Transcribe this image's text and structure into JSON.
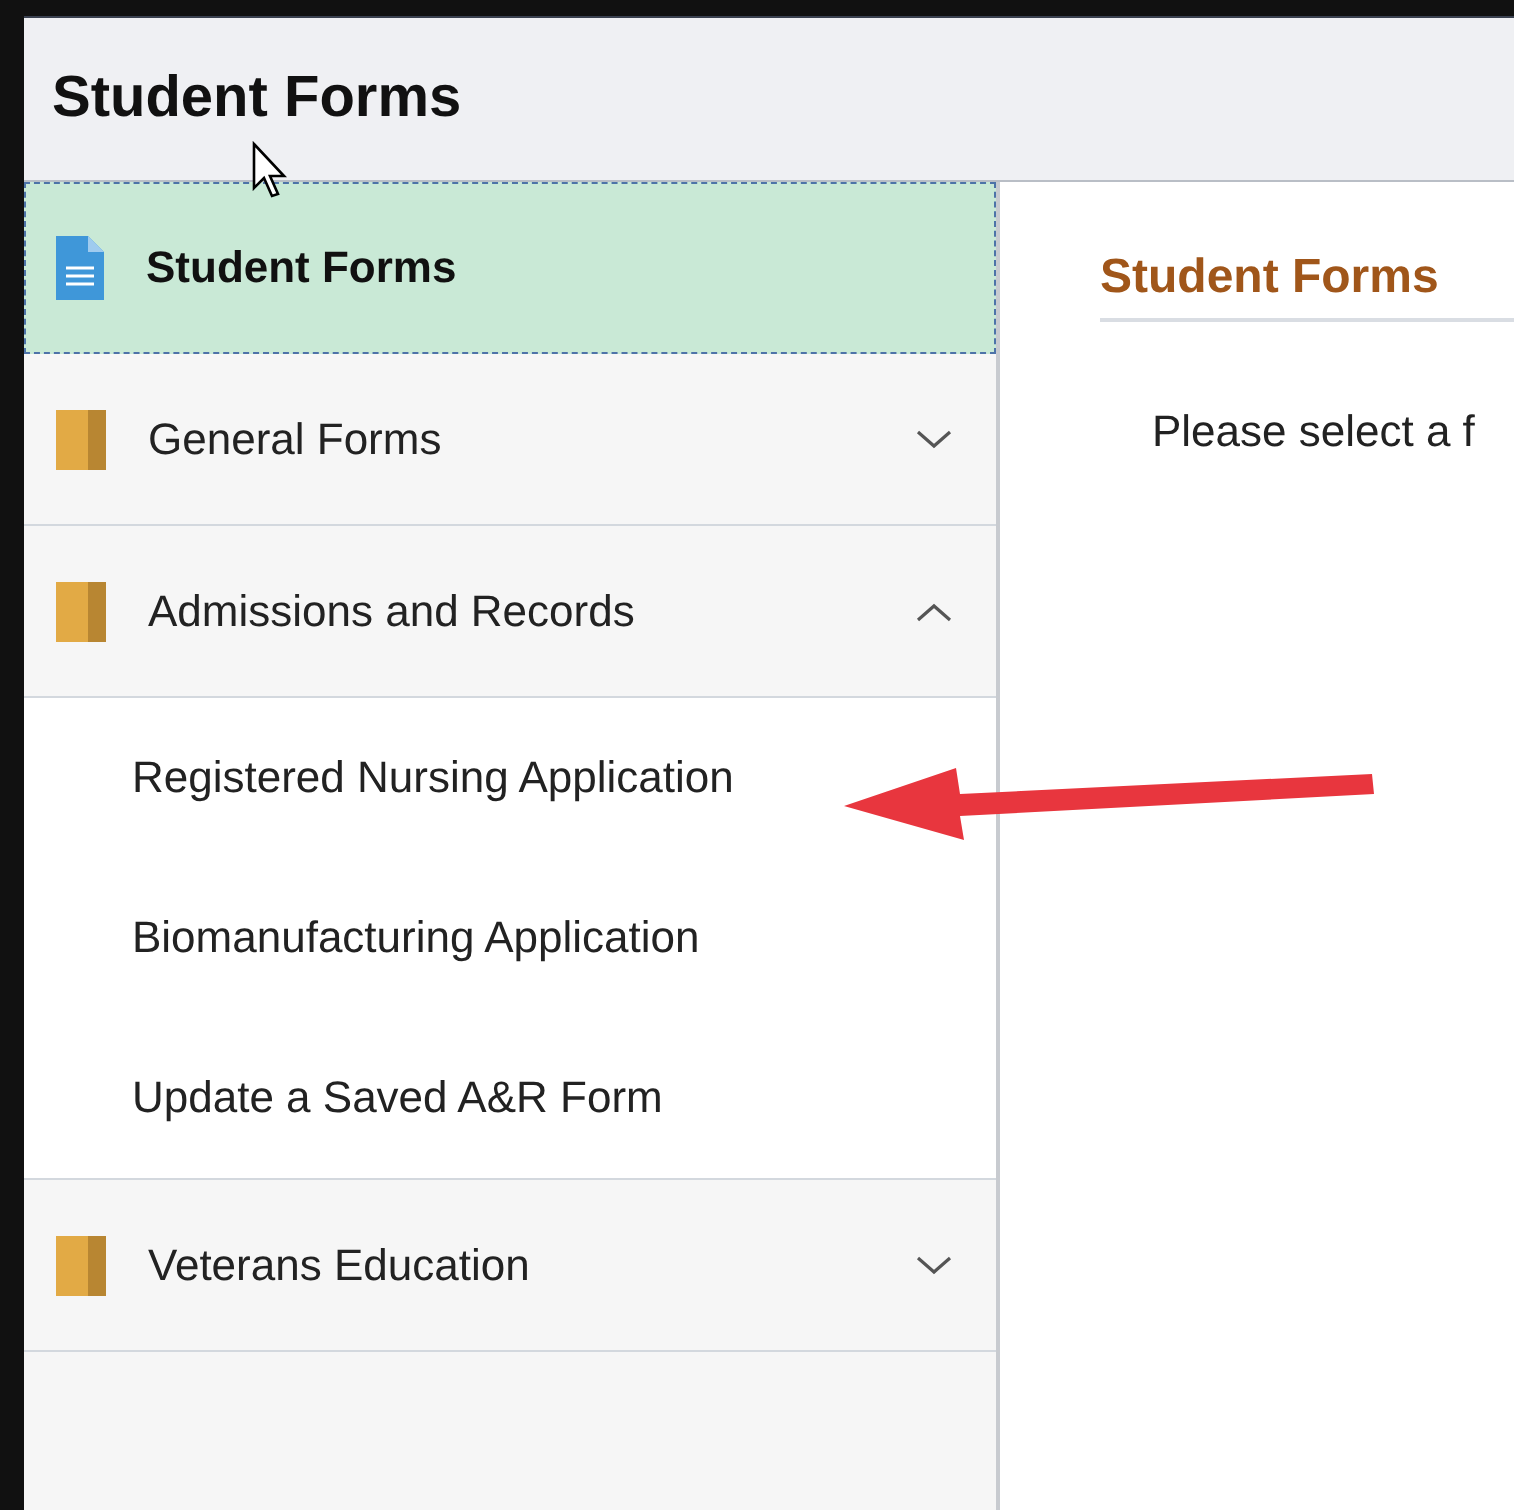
{
  "header": {
    "title": "Student Forms"
  },
  "sidebar": {
    "items": [
      {
        "kind": "page",
        "label": "Student Forms",
        "selected": true
      },
      {
        "kind": "folder",
        "label": "General Forms",
        "selected": false,
        "expanded": false
      },
      {
        "kind": "folder",
        "label": "Admissions and Records",
        "selected": false,
        "expanded": true,
        "children": [
          {
            "label": "Registered Nursing Application",
            "selected": false
          },
          {
            "label": "Biomanufacturing Application",
            "selected": false
          },
          {
            "label": "Update a Saved A&R Form",
            "selected": false
          }
        ]
      },
      {
        "kind": "folder",
        "label": "Veterans Education",
        "selected": false,
        "expanded": false
      }
    ]
  },
  "content": {
    "title": "Student Forms",
    "message": "Please select a f"
  }
}
